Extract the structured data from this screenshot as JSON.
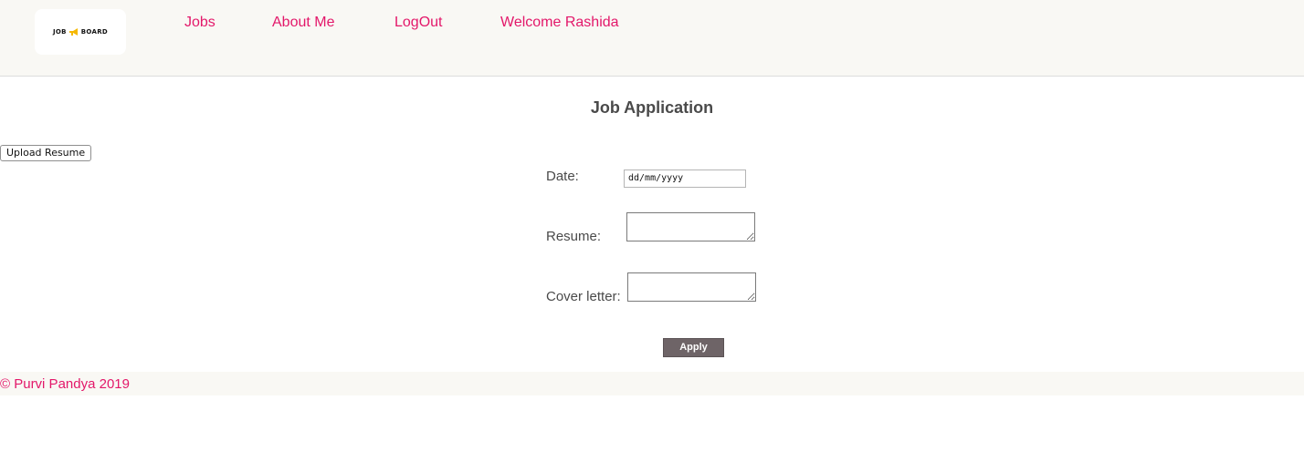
{
  "header": {
    "logo": {
      "left_word": "JOB",
      "right_word": "BOARD",
      "accent_color": "#f5b800"
    },
    "nav": [
      {
        "label": "Jobs"
      },
      {
        "label": "About Me"
      },
      {
        "label": "LogOut"
      },
      {
        "label": "Welcome Rashida"
      }
    ],
    "link_color": "#e3186a"
  },
  "main": {
    "title": "Job Application",
    "upload_button": "Upload Resume",
    "form": {
      "date_label": "Date:",
      "date_placeholder": "dd/mm/yyyy",
      "resume_label": "Resume:",
      "cover_letter_label": "Cover letter:",
      "apply_button": "Apply"
    }
  },
  "footer": {
    "text": "© Purvi Pandya 2019"
  }
}
